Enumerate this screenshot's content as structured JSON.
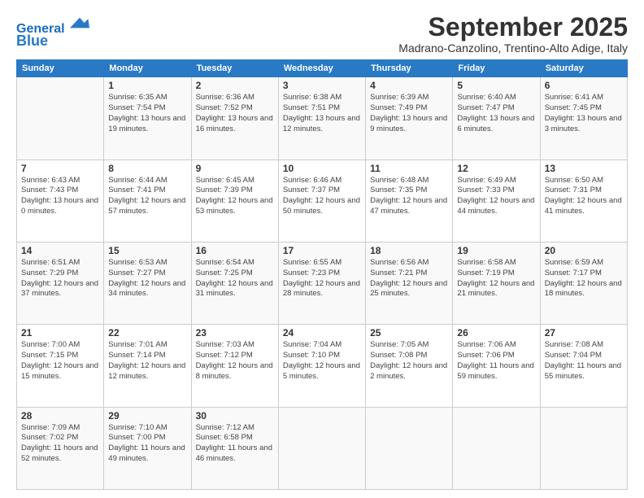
{
  "header": {
    "logo_line1": "General",
    "logo_line2": "Blue",
    "month": "September 2025",
    "location": "Madrano-Canzolino, Trentino-Alto Adige, Italy"
  },
  "days_of_week": [
    "Sunday",
    "Monday",
    "Tuesday",
    "Wednesday",
    "Thursday",
    "Friday",
    "Saturday"
  ],
  "weeks": [
    [
      {
        "day": "",
        "sunrise": "",
        "sunset": "",
        "daylight": ""
      },
      {
        "day": "1",
        "sunrise": "Sunrise: 6:35 AM",
        "sunset": "Sunset: 7:54 PM",
        "daylight": "Daylight: 13 hours and 19 minutes."
      },
      {
        "day": "2",
        "sunrise": "Sunrise: 6:36 AM",
        "sunset": "Sunset: 7:52 PM",
        "daylight": "Daylight: 13 hours and 16 minutes."
      },
      {
        "day": "3",
        "sunrise": "Sunrise: 6:38 AM",
        "sunset": "Sunset: 7:51 PM",
        "daylight": "Daylight: 13 hours and 12 minutes."
      },
      {
        "day": "4",
        "sunrise": "Sunrise: 6:39 AM",
        "sunset": "Sunset: 7:49 PM",
        "daylight": "Daylight: 13 hours and 9 minutes."
      },
      {
        "day": "5",
        "sunrise": "Sunrise: 6:40 AM",
        "sunset": "Sunset: 7:47 PM",
        "daylight": "Daylight: 13 hours and 6 minutes."
      },
      {
        "day": "6",
        "sunrise": "Sunrise: 6:41 AM",
        "sunset": "Sunset: 7:45 PM",
        "daylight": "Daylight: 13 hours and 3 minutes."
      }
    ],
    [
      {
        "day": "7",
        "sunrise": "Sunrise: 6:43 AM",
        "sunset": "Sunset: 7:43 PM",
        "daylight": "Daylight: 13 hours and 0 minutes."
      },
      {
        "day": "8",
        "sunrise": "Sunrise: 6:44 AM",
        "sunset": "Sunset: 7:41 PM",
        "daylight": "Daylight: 12 hours and 57 minutes."
      },
      {
        "day": "9",
        "sunrise": "Sunrise: 6:45 AM",
        "sunset": "Sunset: 7:39 PM",
        "daylight": "Daylight: 12 hours and 53 minutes."
      },
      {
        "day": "10",
        "sunrise": "Sunrise: 6:46 AM",
        "sunset": "Sunset: 7:37 PM",
        "daylight": "Daylight: 12 hours and 50 minutes."
      },
      {
        "day": "11",
        "sunrise": "Sunrise: 6:48 AM",
        "sunset": "Sunset: 7:35 PM",
        "daylight": "Daylight: 12 hours and 47 minutes."
      },
      {
        "day": "12",
        "sunrise": "Sunrise: 6:49 AM",
        "sunset": "Sunset: 7:33 PM",
        "daylight": "Daylight: 12 hours and 44 minutes."
      },
      {
        "day": "13",
        "sunrise": "Sunrise: 6:50 AM",
        "sunset": "Sunset: 7:31 PM",
        "daylight": "Daylight: 12 hours and 41 minutes."
      }
    ],
    [
      {
        "day": "14",
        "sunrise": "Sunrise: 6:51 AM",
        "sunset": "Sunset: 7:29 PM",
        "daylight": "Daylight: 12 hours and 37 minutes."
      },
      {
        "day": "15",
        "sunrise": "Sunrise: 6:53 AM",
        "sunset": "Sunset: 7:27 PM",
        "daylight": "Daylight: 12 hours and 34 minutes."
      },
      {
        "day": "16",
        "sunrise": "Sunrise: 6:54 AM",
        "sunset": "Sunset: 7:25 PM",
        "daylight": "Daylight: 12 hours and 31 minutes."
      },
      {
        "day": "17",
        "sunrise": "Sunrise: 6:55 AM",
        "sunset": "Sunset: 7:23 PM",
        "daylight": "Daylight: 12 hours and 28 minutes."
      },
      {
        "day": "18",
        "sunrise": "Sunrise: 6:56 AM",
        "sunset": "Sunset: 7:21 PM",
        "daylight": "Daylight: 12 hours and 25 minutes."
      },
      {
        "day": "19",
        "sunrise": "Sunrise: 6:58 AM",
        "sunset": "Sunset: 7:19 PM",
        "daylight": "Daylight: 12 hours and 21 minutes."
      },
      {
        "day": "20",
        "sunrise": "Sunrise: 6:59 AM",
        "sunset": "Sunset: 7:17 PM",
        "daylight": "Daylight: 12 hours and 18 minutes."
      }
    ],
    [
      {
        "day": "21",
        "sunrise": "Sunrise: 7:00 AM",
        "sunset": "Sunset: 7:15 PM",
        "daylight": "Daylight: 12 hours and 15 minutes."
      },
      {
        "day": "22",
        "sunrise": "Sunrise: 7:01 AM",
        "sunset": "Sunset: 7:14 PM",
        "daylight": "Daylight: 12 hours and 12 minutes."
      },
      {
        "day": "23",
        "sunrise": "Sunrise: 7:03 AM",
        "sunset": "Sunset: 7:12 PM",
        "daylight": "Daylight: 12 hours and 8 minutes."
      },
      {
        "day": "24",
        "sunrise": "Sunrise: 7:04 AM",
        "sunset": "Sunset: 7:10 PM",
        "daylight": "Daylight: 12 hours and 5 minutes."
      },
      {
        "day": "25",
        "sunrise": "Sunrise: 7:05 AM",
        "sunset": "Sunset: 7:08 PM",
        "daylight": "Daylight: 12 hours and 2 minutes."
      },
      {
        "day": "26",
        "sunrise": "Sunrise: 7:06 AM",
        "sunset": "Sunset: 7:06 PM",
        "daylight": "Daylight: 11 hours and 59 minutes."
      },
      {
        "day": "27",
        "sunrise": "Sunrise: 7:08 AM",
        "sunset": "Sunset: 7:04 PM",
        "daylight": "Daylight: 11 hours and 55 minutes."
      }
    ],
    [
      {
        "day": "28",
        "sunrise": "Sunrise: 7:09 AM",
        "sunset": "Sunset: 7:02 PM",
        "daylight": "Daylight: 11 hours and 52 minutes."
      },
      {
        "day": "29",
        "sunrise": "Sunrise: 7:10 AM",
        "sunset": "Sunset: 7:00 PM",
        "daylight": "Daylight: 11 hours and 49 minutes."
      },
      {
        "day": "30",
        "sunrise": "Sunrise: 7:12 AM",
        "sunset": "Sunset: 6:58 PM",
        "daylight": "Daylight: 11 hours and 46 minutes."
      },
      {
        "day": "",
        "sunrise": "",
        "sunset": "",
        "daylight": ""
      },
      {
        "day": "",
        "sunrise": "",
        "sunset": "",
        "daylight": ""
      },
      {
        "day": "",
        "sunrise": "",
        "sunset": "",
        "daylight": ""
      },
      {
        "day": "",
        "sunrise": "",
        "sunset": "",
        "daylight": ""
      }
    ]
  ]
}
